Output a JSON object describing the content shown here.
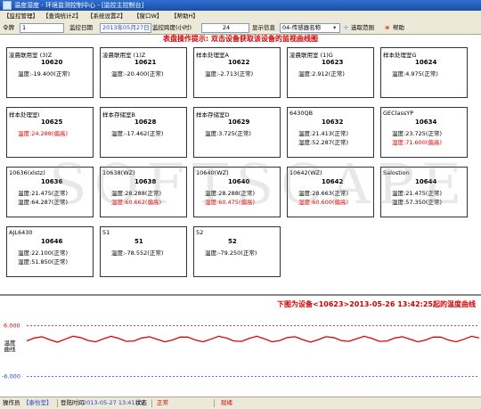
{
  "window": {
    "title": "温度湿度 - 环境监测控制中心 - [监控主控制台]"
  },
  "menu": [
    "【监控管理】",
    "【查询统计Z】",
    "【系统设置Z】",
    "【窗口W】",
    "【帮助H】"
  ],
  "toolbar": {
    "command_label": "令牌",
    "command_value": "1",
    "date_label": "监控日期",
    "date_value": "2013年05月27日",
    "span_label": "监控跨度(小时)",
    "span_value": "24",
    "display_label": "显示信息",
    "display_value": "04-传感器名称",
    "select_range": "选取范围",
    "help": "帮助"
  },
  "hint": "表盘操作提示: 双击设备获取该设备的监视曲线图",
  "cards": [
    {
      "name": "凌晨联用室 (3)Z",
      "id": "10620",
      "temp": "温度:-19.400(正常)",
      "hum": "",
      "tw": false,
      "hw": false
    },
    {
      "name": "凌晨联用室 (1)Z",
      "id": "10621",
      "temp": "温度:-20.400(正常)",
      "hum": "",
      "tw": false,
      "hw": false
    },
    {
      "name": "样本处理室A",
      "id": "10622",
      "temp": "温度:-2.713(正常)",
      "hum": "",
      "tw": false,
      "hw": false
    },
    {
      "name": "凌晨联用室 (1)G",
      "id": "10623",
      "temp": "温度:2.912(正常)",
      "hum": "",
      "tw": false,
      "hw": false
    },
    {
      "name": "样本处理室G",
      "id": "10624",
      "temp": "温度:4.975(正常)",
      "hum": "",
      "tw": false,
      "hw": false
    },
    {
      "name": "样本处理室I",
      "id": "10625",
      "temp": "温度:24.288(偏高)",
      "hum": "",
      "tw": true,
      "hw": false
    },
    {
      "name": "样本存储室B",
      "id": "10628",
      "temp": "温度:-17.462(正常)",
      "hum": "",
      "tw": false,
      "hw": false
    },
    {
      "name": "样本存储室D",
      "id": "10629",
      "temp": "温度:3.725(正常)",
      "hum": "",
      "tw": false,
      "hw": false
    },
    {
      "name": "6430QB",
      "id": "10632",
      "temp": "温度:21.413(正常)",
      "hum": "湿度:52.287(正常)",
      "tw": false,
      "hw": false
    },
    {
      "name": "GEClassYP",
      "id": "10634",
      "temp": "温度:23.725(正常)",
      "hum": "湿度:71.600(偏高)",
      "tw": false,
      "hw": true
    },
    {
      "name": "10636(xlstz)",
      "id": "10636",
      "temp": "温度:21.475(正常)",
      "hum": "湿度:64.287(正常)",
      "tw": false,
      "hw": false
    },
    {
      "name": "10638(WZ)",
      "id": "10638",
      "temp": "温度:28.288(正常)",
      "hum": "湿度:60.662(偏高)",
      "tw": false,
      "hw": true
    },
    {
      "name": "10640(WZ)",
      "id": "10640",
      "temp": "温度:28.288(正常)",
      "hum": "湿度:60.475(偏高)",
      "tw": false,
      "hw": true
    },
    {
      "name": "10642(WZ)",
      "id": "10642",
      "temp": "温度:28.663(正常)",
      "hum": "湿度:60.600(偏高)",
      "tw": false,
      "hw": true
    },
    {
      "name": "Salostion",
      "id": "10644",
      "temp": "温度:21.475(正常)",
      "hum": "湿度:57.350(正常)",
      "tw": false,
      "hw": false
    },
    {
      "name": "AJL6430",
      "id": "10646",
      "temp": "温度:22.100(正常)",
      "hum": "湿度:51.850(正常)",
      "tw": false,
      "hw": false
    },
    {
      "name": "51",
      "id": "51",
      "temp": "温度:-78.552(正常)",
      "hum": "",
      "tw": false,
      "hw": false
    },
    {
      "name": "52",
      "id": "52",
      "temp": "温度:-79.250(正常)",
      "hum": "",
      "tw": false,
      "hw": false
    }
  ],
  "watermark": "SOFTSCAPE",
  "chart": {
    "title": "下图为设备<10623>2013-05-26 13:42:25起的温度曲线",
    "ylabel": "温度曲线",
    "upper_label": "6.000",
    "lower_label": "-6.000",
    "colors": {
      "line": "#e00000",
      "upper": "#e00000",
      "lower": "#2a3fd0"
    }
  },
  "chart_data": {
    "type": "line",
    "upper_limit": 6.0,
    "lower_limit": -6.0,
    "ylim": [
      -8,
      8
    ],
    "values": [
      2.4,
      3.1,
      3.4,
      2.7,
      2.1,
      2.8,
      3.5,
      3.2,
      2.5,
      2.2,
      2.9,
      3.5,
      3.0,
      2.3,
      2.4,
      3.1,
      3.4,
      2.8,
      2.2,
      2.6,
      3.3,
      3.3,
      2.6,
      2.2,
      2.8,
      3.5,
      3.1,
      2.4,
      2.3,
      3.0,
      3.5,
      2.9,
      2.2,
      2.5,
      3.2,
      3.4,
      2.7,
      2.1,
      2.7,
      3.4,
      3.2,
      2.5,
      2.3,
      2.9,
      3.5,
      3.0,
      2.3,
      2.4,
      3.1,
      3.4,
      2.8,
      2.2,
      2.6,
      3.3,
      3.3,
      2.6,
      2.2,
      2.8,
      3.5,
      3.1
    ]
  },
  "status": {
    "operator_label": "操作员",
    "operator_value": "【泰怡莹】",
    "login_label": "登陆时间",
    "login_value": "2013-05-27 13:41:19",
    "state_label": "状态",
    "state_value": "正常",
    "ready_value": "就绪"
  }
}
